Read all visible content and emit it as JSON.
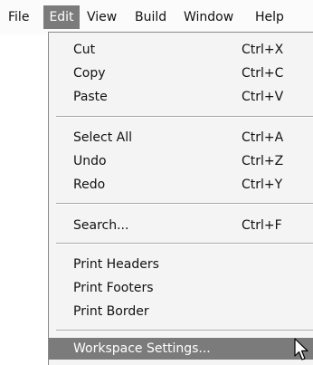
{
  "menubar": {
    "items": [
      {
        "label": "File"
      },
      {
        "label": "Edit"
      },
      {
        "label": "View"
      },
      {
        "label": "Build"
      },
      {
        "label": "Window"
      },
      {
        "label": "Help"
      }
    ]
  },
  "edit_menu": {
    "groups": [
      [
        {
          "label": "Cut",
          "shortcut": "Ctrl+X"
        },
        {
          "label": "Copy",
          "shortcut": "Ctrl+C"
        },
        {
          "label": "Paste",
          "shortcut": "Ctrl+V"
        }
      ],
      [
        {
          "label": "Select All",
          "shortcut": "Ctrl+A"
        },
        {
          "label": "Undo",
          "shortcut": "Ctrl+Z"
        },
        {
          "label": "Redo",
          "shortcut": "Ctrl+Y"
        }
      ],
      [
        {
          "label": "Search...",
          "shortcut": "Ctrl+F"
        }
      ],
      [
        {
          "label": "Print Headers"
        },
        {
          "label": "Print Footers"
        },
        {
          "label": "Print Border"
        }
      ],
      [
        {
          "label": "Workspace Settings..."
        }
      ]
    ],
    "highlighted_item": "Workspace Settings..."
  },
  "colors": {
    "highlight": "#7b7b7b",
    "menu_background": "#f4f4f4"
  },
  "icons": [
    "mouse-pointer-icon"
  ]
}
